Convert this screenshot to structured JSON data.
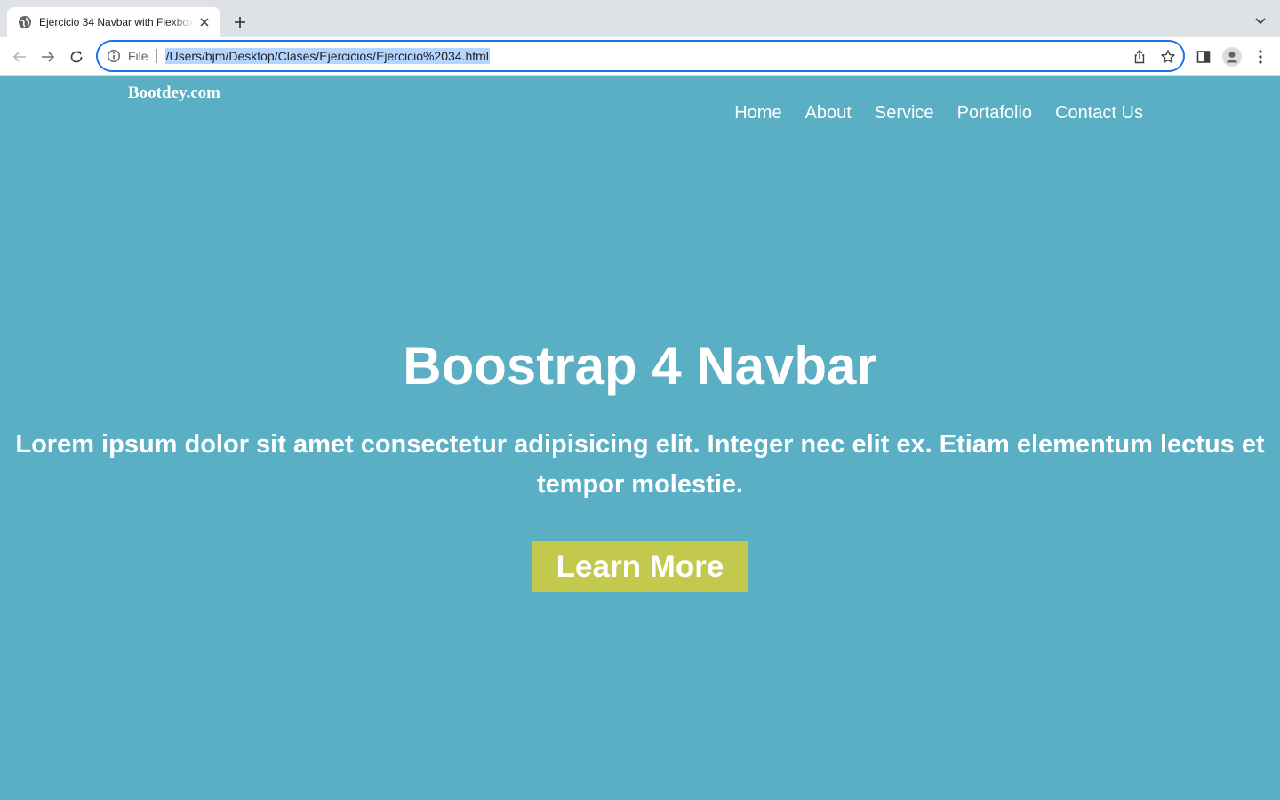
{
  "browser": {
    "tab": {
      "title": "Ejercicio 34 Navbar with Flexbox",
      "favicon": "globe-icon"
    },
    "address_bar": {
      "scheme_label": "File",
      "url": "/Users/bjm/Desktop/Clases/Ejercicios/Ejercicio%2034.html"
    },
    "icons": [
      "back-icon",
      "forward-icon",
      "reload-icon",
      "info-icon",
      "share-icon",
      "star-icon",
      "side-panel-icon",
      "profile-icon",
      "menu-icon",
      "new-tab-icon",
      "tab-search-icon",
      "close-icon"
    ]
  },
  "page": {
    "brand": "Bootdey.com",
    "nav": [
      {
        "label": "Home"
      },
      {
        "label": "About"
      },
      {
        "label": "Service"
      },
      {
        "label": "Portafolio"
      },
      {
        "label": "Contact Us"
      }
    ],
    "hero": {
      "title": "Boostrap 4 Navbar",
      "text": "Lorem ipsum dolor sit amet consectetur adipisicing elit. Integer nec elit ex. Etiam elementum lectus et tempor molestie.",
      "button": "Learn More"
    }
  },
  "colors": {
    "page_background": "#5aafc5",
    "button_background": "#c2c94c",
    "text": "#ffffff",
    "url_highlight": "#b4d5fe",
    "focus_ring": "#1a73e8"
  }
}
